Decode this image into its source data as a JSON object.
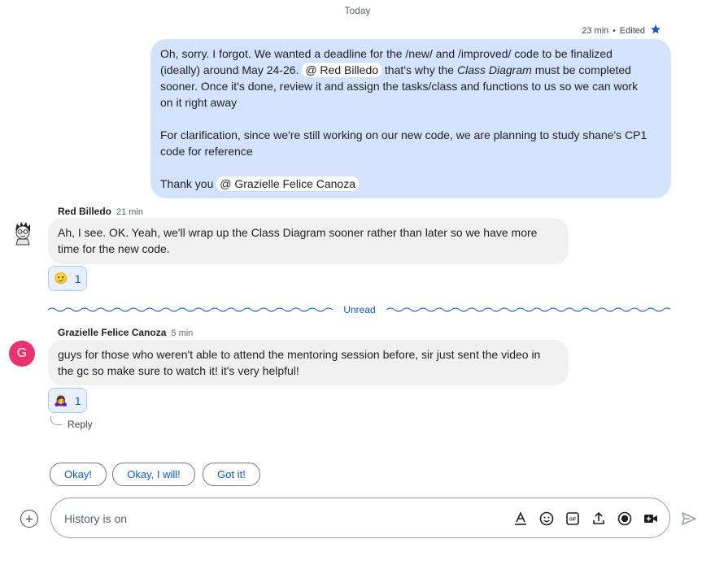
{
  "day_divider": "Today",
  "own_message": {
    "time": "23 min",
    "edited": "Edited",
    "star_icon": "star-icon",
    "line1": "Oh, sorry. I forgot. We wanted a deadline for the /new/ and /improved/ code to be finalized",
    "line2a": "(ideally) around May 24-26.",
    "mention1_at": "@",
    "mention1": "Red Billedo",
    "line2b": "that's why the",
    "line2c_italic": "Class Diagram",
    "line2d": "must be completed",
    "line3": "sooner. Once it's done, review it and assign the tasks/class and functions to us so we can work",
    "line4": "on it right away",
    "para2": "For clarification, since we're still working on our new code, we are planning to study shane's CP1 code for reference",
    "thanks": "Thank you",
    "mention2_at": "@",
    "mention2": "Grazielle Felice Canoza"
  },
  "messages": [
    {
      "sender": "Red Billedo",
      "time": "21 min",
      "text": "Ah, I see. OK. Yeah, we'll wrap up the Class Diagram sooner rather than later so we have more time for the new code.",
      "reaction": {
        "emoji": "🫤",
        "count": "1"
      }
    },
    {
      "sender": "Grazielle Felice Canoza",
      "avatar_letter": "G",
      "time": "5 min",
      "text": "guys for those who weren't able to attend the mentoring session before, sir just sent the video in the gc so make sure to watch it! it's very helpful!",
      "reaction": {
        "emoji": "🙇‍♀️",
        "count": "1"
      }
    }
  ],
  "unread_label": "Unread",
  "reply_label": "Reply",
  "suggestions": [
    "Okay!",
    "Okay, I will!",
    "Got it!"
  ],
  "composer": {
    "placeholder": "History is on",
    "tools": [
      "format-text-icon",
      "emoji-icon",
      "gif-icon",
      "upload-icon",
      "record-icon",
      "video-meeting-icon"
    ]
  },
  "colors": {
    "own_bubble": "#d3e3fd",
    "other_bubble": "#f0f0f0",
    "accent": "#0b57d0",
    "avatar_g": "#e8336f"
  }
}
